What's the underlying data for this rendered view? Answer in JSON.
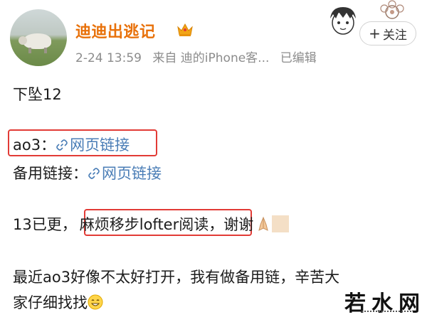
{
  "post": {
    "author": "迪迪出逃记",
    "time": "2-24 13:59",
    "source": "来自 迪的iPhone客...",
    "edited": "已编辑",
    "follow_label": "关注",
    "lines": {
      "l1": "下坠12",
      "ao3_label": "ao3：",
      "ao3_link": "网页链接",
      "backup_label": "备用链接：",
      "backup_link": "网页链接",
      "l4_pre": "13已更，",
      "l4_boxed": "麻烦移步lofter阅读",
      "l4_post": "，谢谢",
      "l5a": "最近ao3好像不太好打开，我有做备用链，辛苦大",
      "l5b": "家仔细找找"
    }
  },
  "watermark": "若水网",
  "icons": [
    "crown-icon",
    "avatar-illustration",
    "link-icon",
    "pray-emoji",
    "smile-emoji",
    "plus-icon"
  ],
  "colors": {
    "username": "#e8710a",
    "link": "#4a7db6",
    "highlight_box": "#e23b36",
    "meta": "#8c8c8c"
  }
}
